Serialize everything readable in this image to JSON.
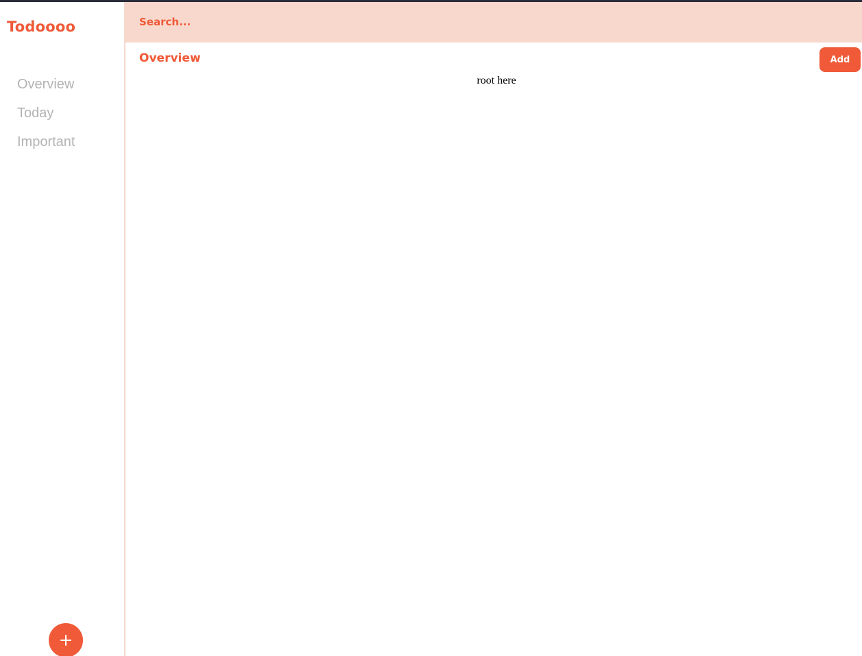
{
  "app": {
    "brand": "Todoooo"
  },
  "sidebar": {
    "items": [
      {
        "label": "Overview"
      },
      {
        "label": "Today"
      },
      {
        "label": "Important"
      }
    ],
    "fab_icon": "plus-icon"
  },
  "search": {
    "placeholder": "Search..."
  },
  "main": {
    "title": "Overview",
    "add_label": "Add",
    "content_text": "root here"
  },
  "colors": {
    "accent": "#f05a38",
    "search_bg": "#f8d8cd",
    "nav_text": "#b3b3b3",
    "divider": "#f5d8cf",
    "top_bar": "#2b2d3a"
  }
}
